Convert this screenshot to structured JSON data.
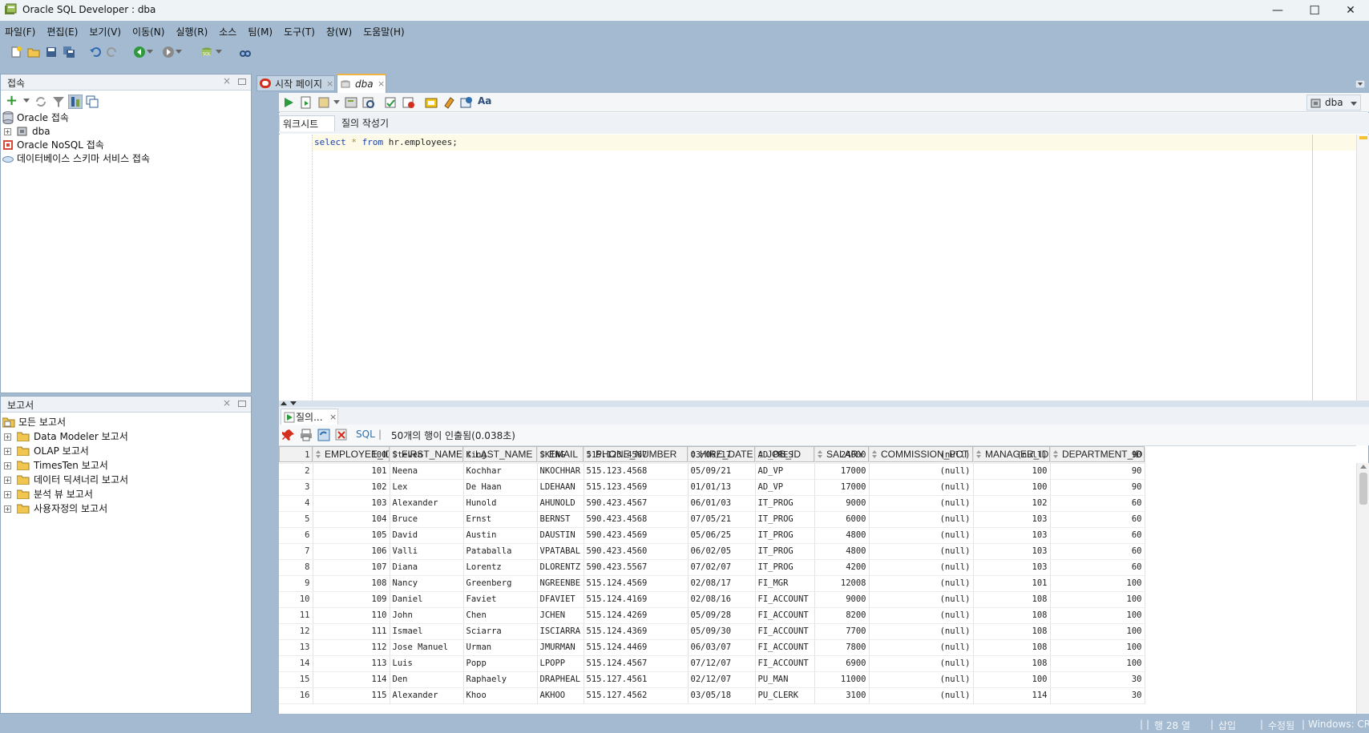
{
  "window": {
    "title": "Oracle SQL Developer : dba",
    "controls": [
      "—",
      "☐",
      "✕"
    ]
  },
  "menu": [
    "파일(F)",
    "편집(E)",
    "보기(V)",
    "이동(N)",
    "실행(R)",
    "소스",
    "팀(M)",
    "도구(T)",
    "창(W)",
    "도움말(H)"
  ],
  "connections": {
    "title": "접속",
    "items": [
      {
        "label": "Oracle 접속",
        "icon": "database-icon",
        "level": 0
      },
      {
        "label": "dba",
        "icon": "connection-icon",
        "level": 1
      },
      {
        "label": "Oracle NoSQL 접속",
        "icon": "nosql-icon",
        "level": 0
      },
      {
        "label": "데이터베이스 스키마 서비스 접속",
        "icon": "cloud-icon",
        "level": 0
      }
    ]
  },
  "reports": {
    "title": "보고서",
    "root": "모든 보고서",
    "items": [
      "Data Modeler 보고서",
      "OLAP 보고서",
      "TimesTen 보고서",
      "데이터 딕셔너리 보고서",
      "분석 뷰 보고서",
      "사용자정의 보고서"
    ]
  },
  "editor_tabs": [
    {
      "label": "시작 페이지",
      "active": false
    },
    {
      "label": "dba",
      "active": true
    }
  ],
  "connection_selector": "dba",
  "worksheet_tabs": [
    {
      "label": "워크시트",
      "active": true
    },
    {
      "label": "질의 작성기",
      "active": false
    }
  ],
  "sql": {
    "kw1": "select",
    "star": "*",
    "kw2": "from",
    "rest": "hr.employees;"
  },
  "results": {
    "tab_label": "질의...",
    "sql_link": "SQL",
    "status": "50개의 행이 인출됨(0.038초)",
    "columns": [
      "EMPLOYEE_ID",
      "FIRST_NAME",
      "LAST_NAME",
      "EMAIL",
      "PHONE_NUMBER",
      "HIRE_DATE",
      "JOB_ID",
      "SALARY",
      "COMMISSION_PCT",
      "MANAGER_ID",
      "DEPARTMENT_ID"
    ],
    "rows": [
      [
        "1",
        "100",
        "Steven",
        "King",
        "SKING",
        "515.123.4567",
        "03/06/17",
        "AD_PRES",
        "24000",
        "(null)",
        "(null)",
        "90"
      ],
      [
        "2",
        "101",
        "Neena",
        "Kochhar",
        "NKOCHHAR",
        "515.123.4568",
        "05/09/21",
        "AD_VP",
        "17000",
        "(null)",
        "100",
        "90"
      ],
      [
        "3",
        "102",
        "Lex",
        "De Haan",
        "LDEHAAN",
        "515.123.4569",
        "01/01/13",
        "AD_VP",
        "17000",
        "(null)",
        "100",
        "90"
      ],
      [
        "4",
        "103",
        "Alexander",
        "Hunold",
        "AHUNOLD",
        "590.423.4567",
        "06/01/03",
        "IT_PROG",
        "9000",
        "(null)",
        "102",
        "60"
      ],
      [
        "5",
        "104",
        "Bruce",
        "Ernst",
        "BERNST",
        "590.423.4568",
        "07/05/21",
        "IT_PROG",
        "6000",
        "(null)",
        "103",
        "60"
      ],
      [
        "6",
        "105",
        "David",
        "Austin",
        "DAUSTIN",
        "590.423.4569",
        "05/06/25",
        "IT_PROG",
        "4800",
        "(null)",
        "103",
        "60"
      ],
      [
        "7",
        "106",
        "Valli",
        "Pataballa",
        "VPATABAL",
        "590.423.4560",
        "06/02/05",
        "IT_PROG",
        "4800",
        "(null)",
        "103",
        "60"
      ],
      [
        "8",
        "107",
        "Diana",
        "Lorentz",
        "DLORENTZ",
        "590.423.5567",
        "07/02/07",
        "IT_PROG",
        "4200",
        "(null)",
        "103",
        "60"
      ],
      [
        "9",
        "108",
        "Nancy",
        "Greenberg",
        "NGREENBE",
        "515.124.4569",
        "02/08/17",
        "FI_MGR",
        "12008",
        "(null)",
        "101",
        "100"
      ],
      [
        "10",
        "109",
        "Daniel",
        "Faviet",
        "DFAVIET",
        "515.124.4169",
        "02/08/16",
        "FI_ACCOUNT",
        "9000",
        "(null)",
        "108",
        "100"
      ],
      [
        "11",
        "110",
        "John",
        "Chen",
        "JCHEN",
        "515.124.4269",
        "05/09/28",
        "FI_ACCOUNT",
        "8200",
        "(null)",
        "108",
        "100"
      ],
      [
        "12",
        "111",
        "Ismael",
        "Sciarra",
        "ISCIARRA",
        "515.124.4369",
        "05/09/30",
        "FI_ACCOUNT",
        "7700",
        "(null)",
        "108",
        "100"
      ],
      [
        "13",
        "112",
        "Jose Manuel",
        "Urman",
        "JMURMAN",
        "515.124.4469",
        "06/03/07",
        "FI_ACCOUNT",
        "7800",
        "(null)",
        "108",
        "100"
      ],
      [
        "14",
        "113",
        "Luis",
        "Popp",
        "LPOPP",
        "515.124.4567",
        "07/12/07",
        "FI_ACCOUNT",
        "6900",
        "(null)",
        "108",
        "100"
      ],
      [
        "15",
        "114",
        "Den",
        "Raphaely",
        "DRAPHEAL",
        "515.127.4561",
        "02/12/07",
        "PU_MAN",
        "11000",
        "(null)",
        "100",
        "30"
      ],
      [
        "16",
        "115",
        "Alexander",
        "Khoo",
        "AKHOO",
        "515.127.4562",
        "03/05/18",
        "PU_CLERK",
        "3100",
        "(null)",
        "114",
        "30"
      ]
    ]
  },
  "statusbar": {
    "sep": "|",
    "line": "행 28 열",
    "mode": "삽입",
    "modified": "수정됨",
    "eol": "Windows: CR"
  }
}
